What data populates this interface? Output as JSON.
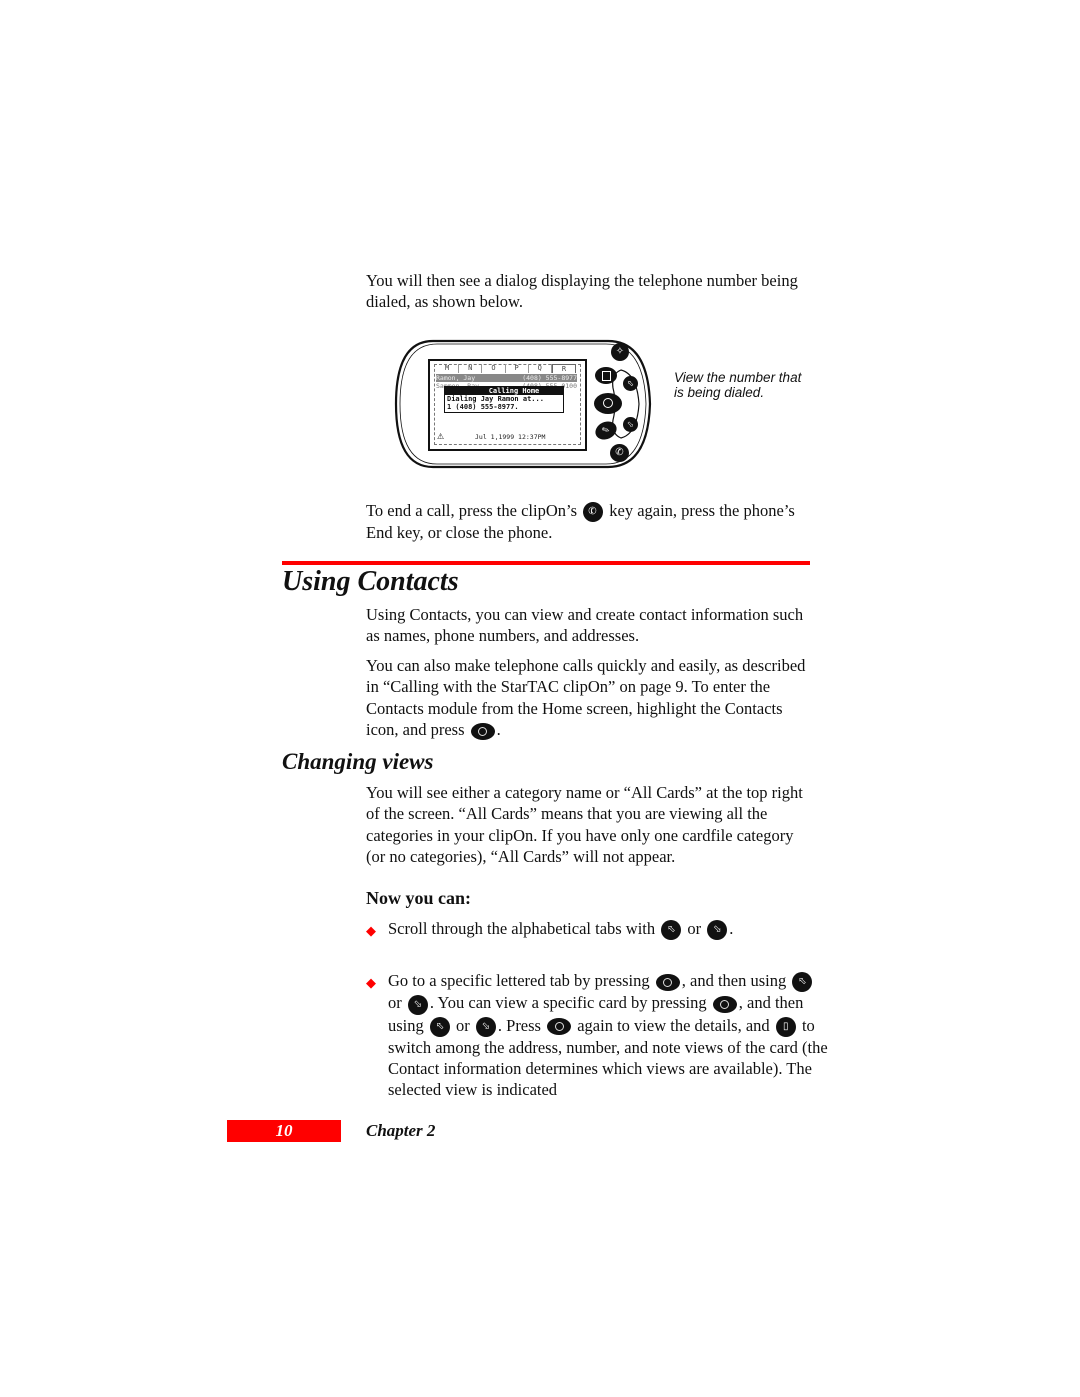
{
  "intro": {
    "text": "You will then see a dialog displaying the telephone number being dialed, as shown below."
  },
  "device": {
    "tabs": [
      "M",
      "N",
      "O",
      "P",
      "Q",
      "R"
    ],
    "list_rows": [
      {
        "name": "Ramon, Jay",
        "number": "(408) 555-8977"
      },
      {
        "name": "Sammon, Ray",
        "number": "(408) 555-0100"
      }
    ],
    "dialog": {
      "title": "Calling Home",
      "line1": "Dialing Jay Ramon at...",
      "line2": "1 (408) 555-8977."
    },
    "status_bar": "Jul 1,1999 12:37PM",
    "buttons": [
      "star-key",
      "view-key",
      "select-key",
      "edit-key",
      "send-key",
      "scroll-up-key",
      "scroll-down-key"
    ]
  },
  "caption": {
    "text": "View the number that is being dialed."
  },
  "end_call": {
    "part1": "To end a call, press the clipOn’s",
    "part2": "key again, press the phone’s End key, or close the phone."
  },
  "section": {
    "title": "Using Contacts",
    "p1": "Using Contacts, you can view and create contact information such as names, phone numbers, and addresses.",
    "p2": "You can also make telephone calls quickly and easily, as described in “Calling with the StarTAC clipOn” on page 9. To enter the Contacts module from the Home screen, highlight the Contacts icon, and press",
    "p2_end": "."
  },
  "subsection": {
    "title": "Changing views",
    "p1": "You will see either a category name or “All Cards” at the top right of the screen. “All Cards” means that you are viewing all the categories in your clipOn. If you have only one cardfile category (or no categories), “All Cards” will not appear.",
    "now_you_can": "Now you can:",
    "bullets": [
      {
        "parts": [
          "Scroll through the alphabetical tabs with",
          "or",
          "."
        ]
      },
      {
        "parts": [
          "Go to a specific lettered tab by pressing",
          ", and then using",
          "or",
          ". You can view a specific card by pressing",
          ", and then using",
          "or",
          ". Press",
          "again to view the details, and",
          "to switch among the address, number, and note views of the card (the Contact information determines which views are available). The selected view is indicated"
        ]
      }
    ]
  },
  "footer": {
    "page_number": "10",
    "chapter": "Chapter 2"
  },
  "colors": {
    "accent": "#ff0000",
    "text": "#111111"
  }
}
